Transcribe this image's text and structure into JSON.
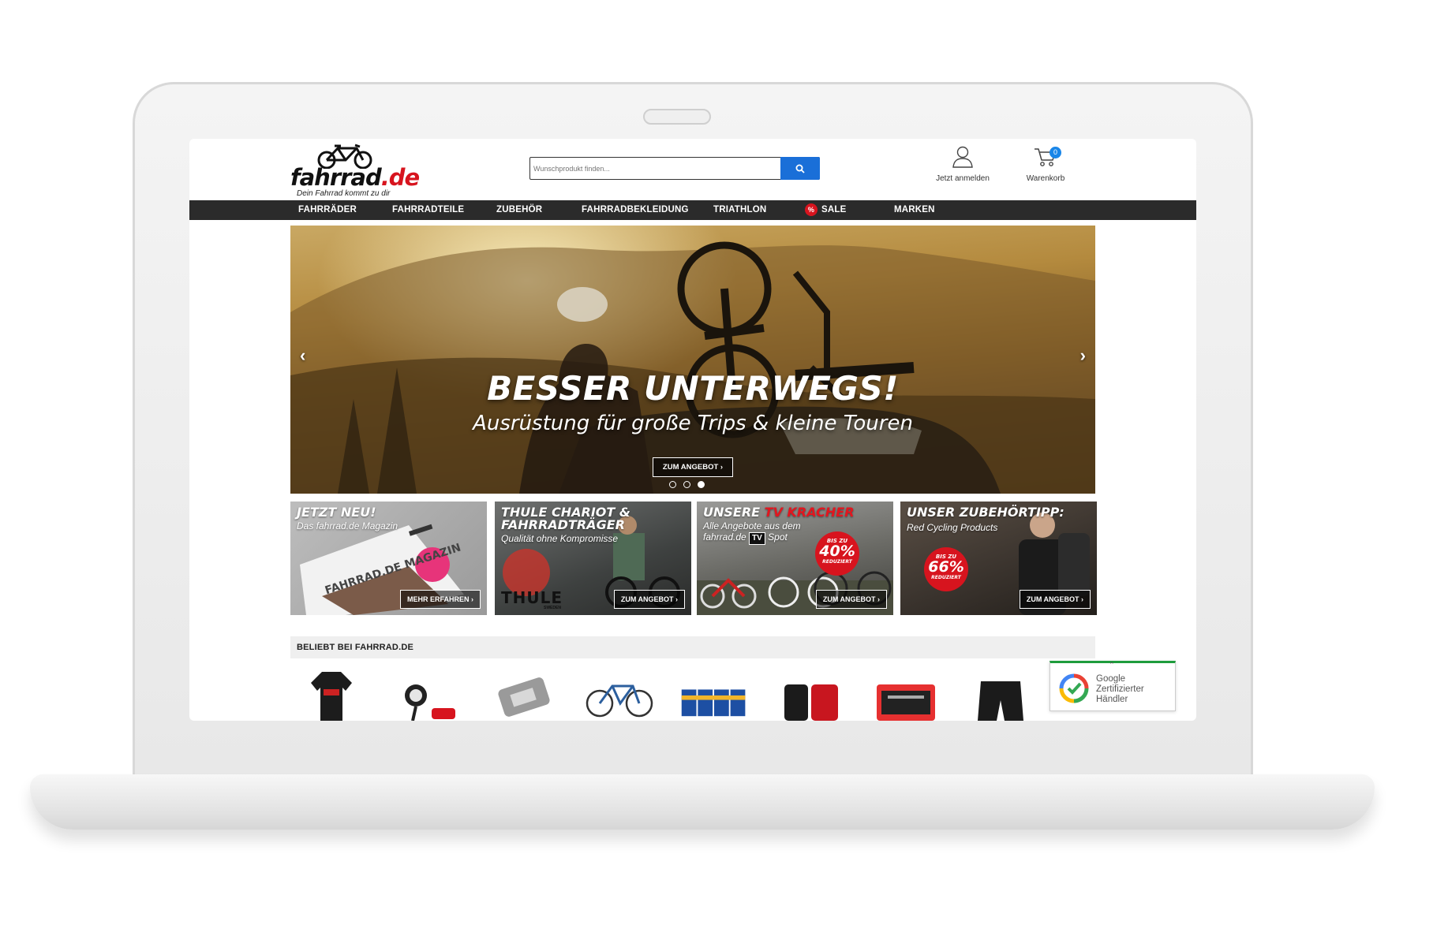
{
  "brand": {
    "name_main": "fahrrad",
    "name_tld": ".de",
    "tagline": "Dein Fahrrad kommt zu dir"
  },
  "search": {
    "placeholder": "Wunschprodukt finden..."
  },
  "header": {
    "account_label": "Jetzt anmelden",
    "cart_label": "Warenkorb",
    "cart_count": "0"
  },
  "nav": {
    "items": [
      "FAHRRÄDER",
      "FAHRRADTEILE",
      "ZUBEHÖR",
      "FAHRRADBEKLEIDUNG",
      "TRIATHLON",
      "SALE",
      "MARKEN"
    ],
    "sale_icon": "%"
  },
  "hero": {
    "title": "BESSER UNTERWEGS!",
    "subtitle": "Ausrüstung für große Trips & kleine Touren",
    "cta": "ZUM ANGEBOT",
    "slide_count": 3,
    "active_slide": 3
  },
  "teasers": [
    {
      "title": "JETZT NEU!",
      "subtitle": "Das fahrrad.de Magazin",
      "cover_title": "MAGAZIN",
      "cover_top": "FAHRRAD.DE",
      "cta": "MEHR ERFAHREN"
    },
    {
      "title_line1": "THULE CHARIOT &",
      "title_line2": "FAHRRADTRÄGER",
      "subtitle": "Qualität ohne Kompromisse",
      "brand_mark": "THULE",
      "brand_sub": "SWEDEN",
      "cta": "ZUM ANGEBOT"
    },
    {
      "title_prefix": "UNSERE ",
      "title_highlight": "TV KRACHER",
      "subtitle_line1": "Alle Angebote aus dem",
      "subtitle_line2_prefix": "fahrrad.de ",
      "tv_badge": "TV",
      "subtitle_line2_suffix": " Spot",
      "badge_small": "BIS ZU",
      "badge_big": "40%",
      "badge_text": "REDUZIERT",
      "cta": "ZUM ANGEBOT"
    },
    {
      "title": "UNSER ZUBEHÖRTIPP:",
      "subtitle": "Red Cycling Products",
      "badge_small": "BIS ZU",
      "badge_big": "66%",
      "badge_text": "REDUZIERT",
      "cta": "ZUM ANGEBOT"
    }
  ],
  "popular": {
    "title": "BELIEBT BEI FAHRRAD.DE",
    "items": [
      "jersey-icon",
      "bike-light-icon",
      "pedal-icon",
      "bicycle-icon",
      "tube-boxes-icon",
      "pannier-bag-icon",
      "toolbox-icon",
      "shorts-icon"
    ]
  },
  "google_badge": {
    "line1": "Google",
    "line2": "Zertifizierter",
    "line3": "Händler"
  },
  "colors": {
    "nav_bg": "#2b2b2b",
    "brand_red": "#d7141e",
    "search_blue": "#1a6fd8",
    "badge_green": "#1e9c3c"
  }
}
